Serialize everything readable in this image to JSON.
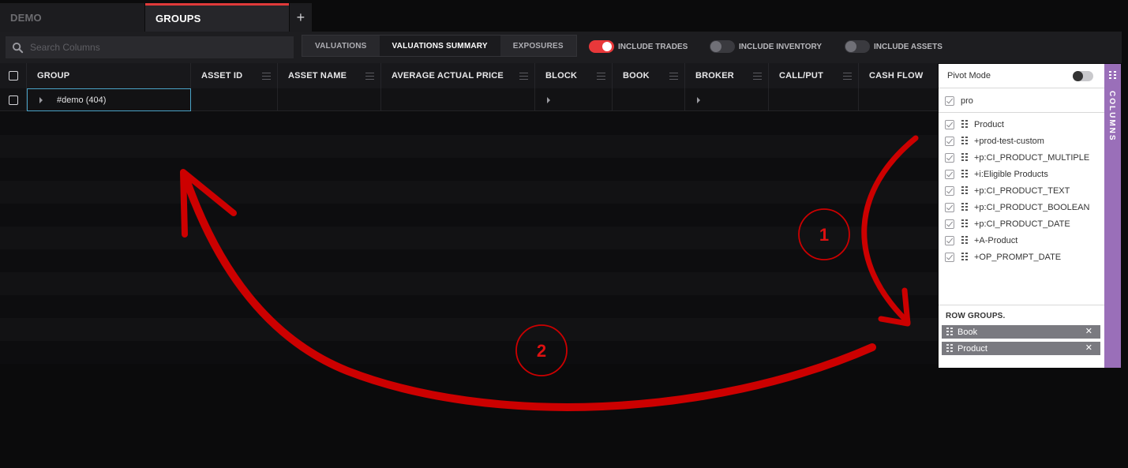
{
  "tabs": [
    {
      "label": "DEMO"
    },
    {
      "label": "GROUPS"
    },
    {
      "label": "+"
    }
  ],
  "toolbar": {
    "search_placeholder": "Search Columns",
    "view_tabs": [
      {
        "label": "VALUATIONS"
      },
      {
        "label": "VALUATIONS SUMMARY"
      },
      {
        "label": "EXPOSURES"
      }
    ],
    "toggles": [
      {
        "label": "INCLUDE TRADES",
        "on": true
      },
      {
        "label": "INCLUDE INVENTORY",
        "on": false
      },
      {
        "label": "INCLUDE ASSETS",
        "on": false
      }
    ]
  },
  "grid": {
    "columns": [
      "GROUP",
      "ASSET ID",
      "ASSET NAME",
      "AVERAGE ACTUAL PRICE",
      "BLOCK",
      "BOOK",
      "BROKER",
      "CALL/PUT",
      "CASH FLOW"
    ],
    "rows": [
      {
        "group": "#demo (404)"
      }
    ]
  },
  "column_panel": {
    "pivot_mode_label": "Pivot Mode",
    "filter_value": "pro",
    "items": [
      "Product",
      "+prod-test-custom",
      "+p:CI_PRODUCT_MULTIPLE",
      "+i:Eligible Products",
      "+p:CI_PRODUCT_TEXT",
      "+p:CI_PRODUCT_BOOLEAN",
      "+p:CI_PRODUCT_DATE",
      "+A-Product",
      "+OP_PROMPT_DATE"
    ],
    "row_groups_title": "ROW GROUPS.",
    "row_groups": [
      "Book",
      "Product"
    ],
    "side_tab_label": "COLUMNS"
  },
  "annotations": {
    "step1": "1",
    "step2": "2"
  },
  "colors": {
    "accent_red": "#e8383a",
    "annotation_red": "#cc0000",
    "side_tab_purple": "#9a6fb9"
  }
}
